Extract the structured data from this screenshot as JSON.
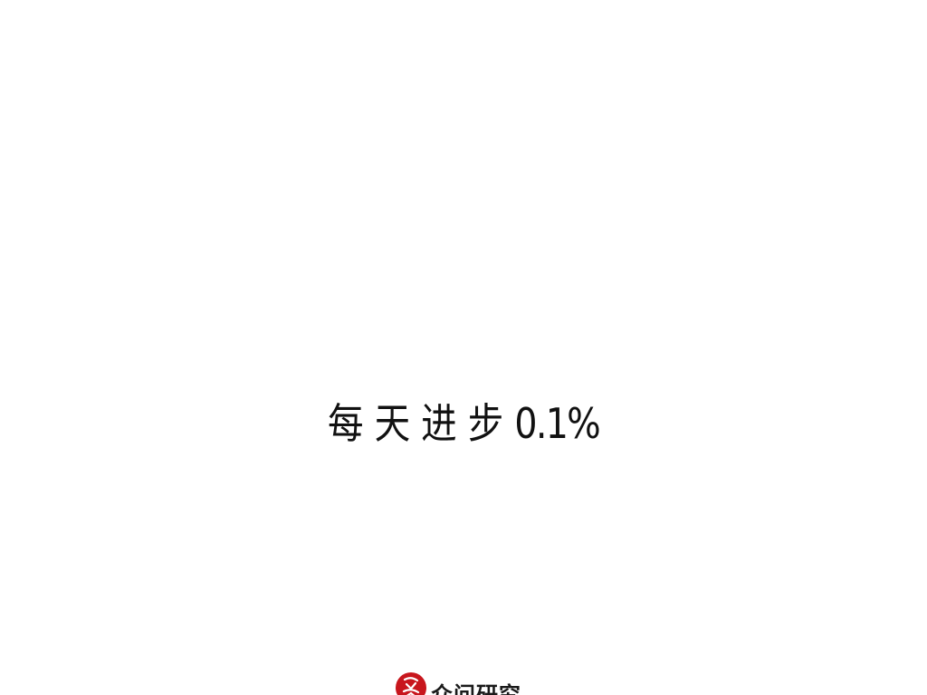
{
  "slogan": {
    "chars": [
      "每",
      "天",
      "进",
      "步"
    ],
    "number": "0.1%"
  },
  "brand": {
    "name": "众问研究",
    "logo_icon": "red-seal-logo",
    "logo_color": "#c8161d"
  },
  "colors": {
    "background": "#ffffff",
    "text": "#111111"
  }
}
